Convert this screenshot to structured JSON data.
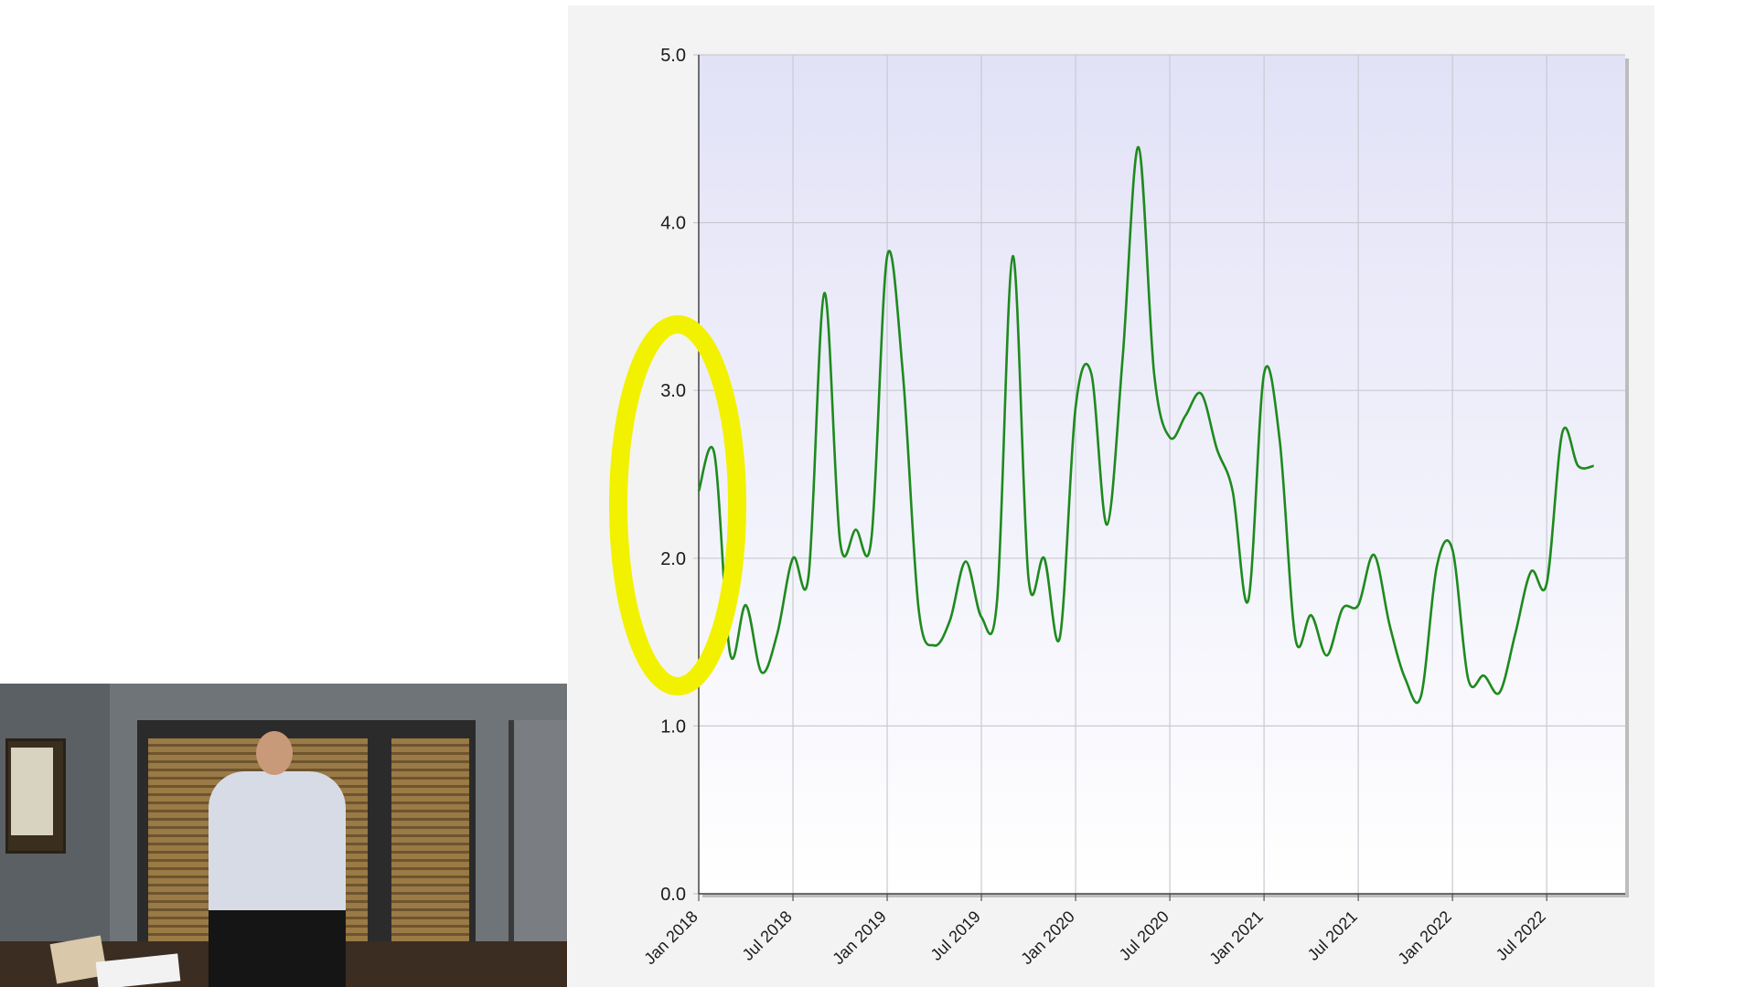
{
  "chart_data": {
    "type": "line",
    "x_ticks": [
      "Jan 2018",
      "Jul 2018",
      "Jan 2019",
      "Jul 2019",
      "Jan 2020",
      "Jul 2020",
      "Jan 2021",
      "Jul 2021",
      "Jan 2022",
      "Jul 2022"
    ],
    "y_ticks": [
      "0.0",
      "1.0",
      "2.0",
      "3.0",
      "4.0",
      "5.0"
    ],
    "ylim": [
      0,
      5
    ],
    "xlim": [
      "2018-01",
      "2022-12"
    ],
    "grid": true,
    "series": [
      {
        "color": "#1e8a1e",
        "points": [
          [
            "2018-01",
            2.4
          ],
          [
            "2018-02",
            2.62
          ],
          [
            "2018-03",
            1.43
          ],
          [
            "2018-04",
            1.72
          ],
          [
            "2018-05",
            1.32
          ],
          [
            "2018-06",
            1.55
          ],
          [
            "2018-07",
            2.0
          ],
          [
            "2018-08",
            1.9
          ],
          [
            "2018-09",
            3.58
          ],
          [
            "2018-10",
            2.1
          ],
          [
            "2018-11",
            2.17
          ],
          [
            "2018-12",
            2.12
          ],
          [
            "2019-01",
            3.8
          ],
          [
            "2019-02",
            3.1
          ],
          [
            "2019-03",
            1.7
          ],
          [
            "2019-04",
            1.48
          ],
          [
            "2019-05",
            1.63
          ],
          [
            "2019-06",
            1.98
          ],
          [
            "2019-07",
            1.65
          ],
          [
            "2019-08",
            1.75
          ],
          [
            "2019-09",
            3.8
          ],
          [
            "2019-10",
            1.88
          ],
          [
            "2019-11",
            2.0
          ],
          [
            "2019-12",
            1.53
          ],
          [
            "2020-01",
            2.9
          ],
          [
            "2020-02",
            3.1
          ],
          [
            "2020-03",
            2.2
          ],
          [
            "2020-04",
            3.2
          ],
          [
            "2020-05",
            4.45
          ],
          [
            "2020-06",
            3.1
          ],
          [
            "2020-07",
            2.72
          ],
          [
            "2020-08",
            2.85
          ],
          [
            "2020-09",
            2.98
          ],
          [
            "2020-10",
            2.65
          ],
          [
            "2020-11",
            2.4
          ],
          [
            "2020-12",
            1.75
          ],
          [
            "2021-01",
            3.1
          ],
          [
            "2021-02",
            2.7
          ],
          [
            "2021-03",
            1.52
          ],
          [
            "2021-04",
            1.66
          ],
          [
            "2021-05",
            1.42
          ],
          [
            "2021-06",
            1.7
          ],
          [
            "2021-07",
            1.72
          ],
          [
            "2021-08",
            2.02
          ],
          [
            "2021-09",
            1.6
          ],
          [
            "2021-10",
            1.28
          ],
          [
            "2021-11",
            1.18
          ],
          [
            "2021-12",
            1.95
          ],
          [
            "2022-01",
            2.05
          ],
          [
            "2022-02",
            1.28
          ],
          [
            "2022-03",
            1.3
          ],
          [
            "2022-04",
            1.2
          ],
          [
            "2022-05",
            1.55
          ],
          [
            "2022-06",
            1.92
          ],
          [
            "2022-07",
            1.85
          ],
          [
            "2022-08",
            2.75
          ],
          [
            "2022-09",
            2.55
          ],
          [
            "2022-10",
            2.55
          ]
        ]
      }
    ],
    "annotation": {
      "shape": "ellipse",
      "color": "#f2f200",
      "around": "2018-01"
    }
  }
}
